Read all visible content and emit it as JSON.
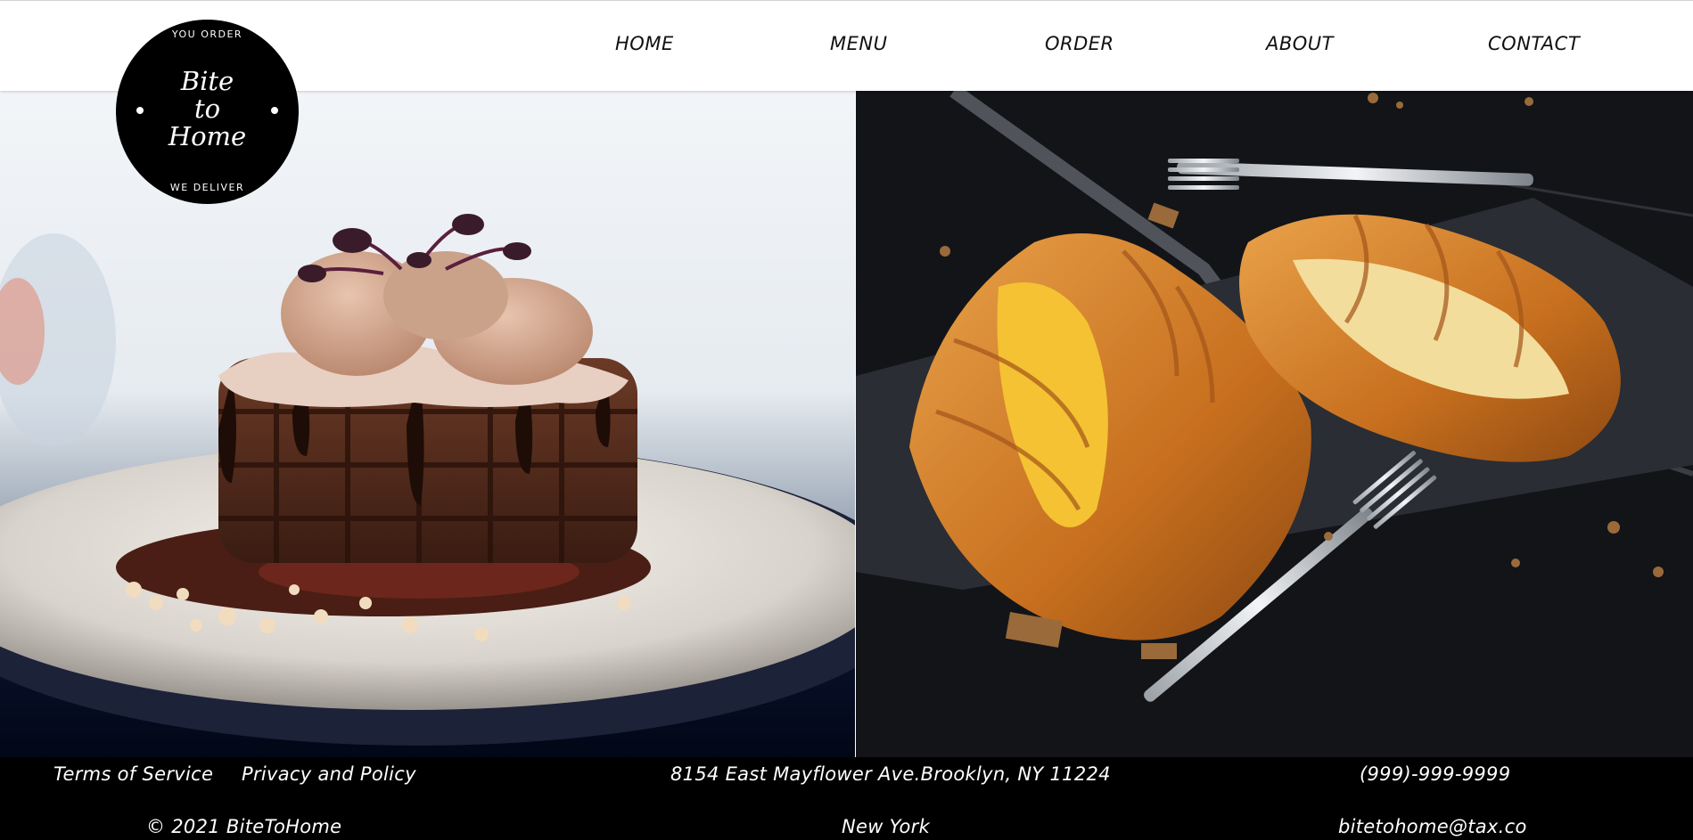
{
  "logo": {
    "top_text": "YOU ORDER",
    "name_lines": [
      "Bite",
      "to",
      "Home"
    ],
    "bottom_text": "WE DELIVER"
  },
  "nav": {
    "items": [
      {
        "label": "HOME"
      },
      {
        "label": "MENU"
      },
      {
        "label": "ORDER"
      },
      {
        "label": "ABOUT"
      },
      {
        "label": "CONTACT"
      }
    ]
  },
  "hero": {
    "left_image": "chocolate-waffles-with-ice-cream-photo",
    "right_image": "croissants-with-forks-on-slate-photo"
  },
  "footer": {
    "terms": "Terms of Service",
    "privacy": "Privacy and Policy",
    "address": "8154 East Mayflower Ave.Brooklyn, NY 11224",
    "phone": "(999)-999-9999",
    "copyright": "© 2021 BiteToHome",
    "city": "New York",
    "email": "bitetohome@tax.co"
  }
}
